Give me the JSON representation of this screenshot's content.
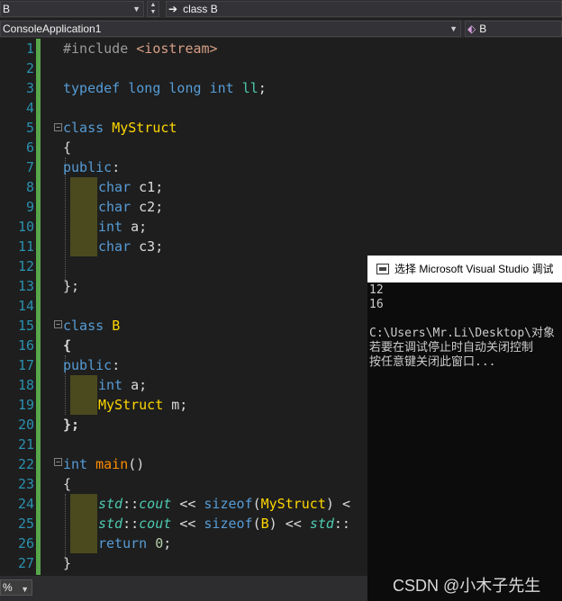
{
  "nav_top": {
    "left_combo": "B",
    "right_combo": "class B"
  },
  "nav_second": {
    "project_combo": "ConsoleApplication1",
    "member_combo": "B"
  },
  "editor": {
    "line_numbers": [
      "1",
      "2",
      "3",
      "4",
      "5",
      "6",
      "7",
      "8",
      "9",
      "10",
      "11",
      "12",
      "13",
      "14",
      "15",
      "16",
      "17",
      "18",
      "19",
      "20",
      "21",
      "22",
      "23",
      "24",
      "25",
      "26",
      "27"
    ],
    "lines": {
      "l1_directive": "#include",
      "l1_header": "<iostream>",
      "l3_typedef": "typedef",
      "l3_long1": "long",
      "l3_long2": "long",
      "l3_int": "int",
      "l3_name": "ll",
      "l3_semi": ";",
      "l5_class": "class",
      "l5_name": "MyStruct",
      "l6": "{",
      "l7_public": "public",
      "l7_colon": ":",
      "l8_type": "char",
      "l8_rest": "c1;",
      "l9_type": "char",
      "l9_rest": "c2;",
      "l10_type": "int",
      "l10_rest": "a;",
      "l11_type": "char",
      "l11_rest": "c3;",
      "l13": "};",
      "l15_class": "class",
      "l15_name": "B",
      "l16": "{",
      "l17_public": "public",
      "l17_colon": ":",
      "l18_type": "int",
      "l18_rest": "a;",
      "l19_type": "MyStruct",
      "l19_rest": "m;",
      "l20": "};",
      "l22_int": "int",
      "l22_main": "main",
      "l22_parens": "()",
      "l23": "{",
      "l24_std": "std",
      "l24_sep": "::",
      "l24_cout": "cout",
      "l24_op": "<<",
      "l24_sizeof": "sizeof",
      "l24_open": "(",
      "l24_arg": "MyStruct",
      "l24_close": ")",
      "l24_tail": "<",
      "l25_std": "std",
      "l25_sep": "::",
      "l25_cout": "cout",
      "l25_op": "<<",
      "l25_sizeof": "sizeof",
      "l25_open": "(",
      "l25_arg": "B",
      "l25_close": ")",
      "l25_op2": "<<",
      "l25_std2": "std",
      "l25_sep2": "::",
      "l26_return": "return",
      "l26_val": "0",
      "l26_semi": ";",
      "l27": "}"
    }
  },
  "console": {
    "title": "选择 Microsoft Visual Studio 调试",
    "output": [
      "12",
      "16",
      "",
      "C:\\Users\\Mr.Li\\Desktop\\对象",
      "若要在调试停止时自动关闭控制",
      "按任意键关闭此窗口..."
    ]
  },
  "status": {
    "zoom": "%"
  },
  "watermark": "CSDN @小木子先生",
  "colors": {
    "keyword": "#569cd6",
    "class_name": "#ffd700",
    "function": "#dcdcaa",
    "string": "#d69d85",
    "line_number": "#2b91af",
    "change_margin": "#57a64a"
  }
}
